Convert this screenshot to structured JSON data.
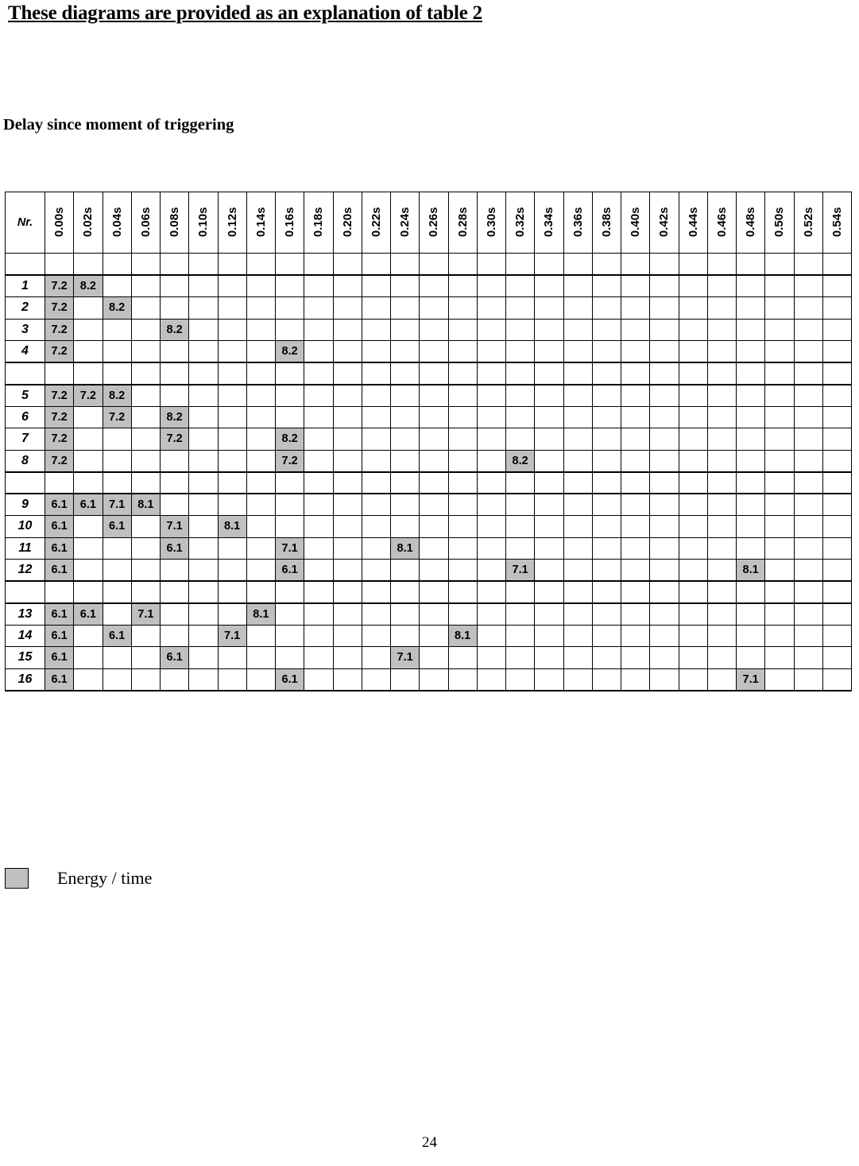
{
  "document": {
    "title": "These diagrams are provided as an explanation of table 2",
    "subheading": "Delay since moment of triggering",
    "page_number": "24"
  },
  "table": {
    "nr_header": "Nr.",
    "time_headers": [
      "0.00s",
      "0.02s",
      "0.04s",
      "0.06s",
      "0.08s",
      "0.10s",
      "0.12s",
      "0.14s",
      "0.16s",
      "0.18s",
      "0.20s",
      "0.22s",
      "0.24s",
      "0.26s",
      "0.28s",
      "0.30s",
      "0.32s",
      "0.34s",
      "0.36s",
      "0.38s",
      "0.40s",
      "0.42s",
      "0.44s",
      "0.46s",
      "0.48s",
      "0.50s",
      "0.52s",
      "0.54s"
    ],
    "column_count": 28,
    "highlight_color": "#c0c0c0",
    "rows": [
      {
        "type": "spacer"
      },
      {
        "type": "data",
        "group_start": true,
        "nr": "1",
        "cells": {
          "0": "7.2",
          "1": "8.2"
        }
      },
      {
        "type": "data",
        "nr": "2",
        "cells": {
          "0": "7.2",
          "2": "8.2"
        }
      },
      {
        "type": "data",
        "nr": "3",
        "cells": {
          "0": "7.2",
          "4": "8.2"
        }
      },
      {
        "type": "data",
        "nr": "4",
        "cells": {
          "0": "7.2",
          "8": "8.2"
        }
      },
      {
        "type": "spacer",
        "group_start": true
      },
      {
        "type": "data",
        "group_start": true,
        "nr": "5",
        "cells": {
          "0": "7.2",
          "1": "7.2",
          "2": "8.2"
        }
      },
      {
        "type": "data",
        "nr": "6",
        "cells": {
          "0": "7.2",
          "2": "7.2",
          "4": "8.2"
        }
      },
      {
        "type": "data",
        "nr": "7",
        "cells": {
          "0": "7.2",
          "4": "7.2",
          "8": "8.2"
        }
      },
      {
        "type": "data",
        "nr": "8",
        "cells": {
          "0": "7.2",
          "8": "7.2",
          "16": "8.2"
        }
      },
      {
        "type": "spacer",
        "group_start": true
      },
      {
        "type": "data",
        "group_start": true,
        "nr": "9",
        "cells": {
          "0": "6.1",
          "1": "6.1",
          "2": "7.1",
          "3": "8.1"
        }
      },
      {
        "type": "data",
        "nr": "10",
        "cells": {
          "0": "6.1",
          "2": "6.1",
          "4": "7.1",
          "6": "8.1"
        }
      },
      {
        "type": "data",
        "nr": "11",
        "cells": {
          "0": "6.1",
          "4": "6.1",
          "8": "7.1",
          "12": "8.1"
        }
      },
      {
        "type": "data",
        "nr": "12",
        "cells": {
          "0": "6.1",
          "8": "6.1",
          "16": "7.1",
          "24": "8.1"
        }
      },
      {
        "type": "spacer",
        "group_start": true
      },
      {
        "type": "data",
        "group_start": true,
        "nr": "13",
        "cells": {
          "0": "6.1",
          "1": "6.1",
          "3": "7.1",
          "7": "8.1"
        }
      },
      {
        "type": "data",
        "nr": "14",
        "cells": {
          "0": "6.1",
          "2": "6.1",
          "6": "7.1",
          "14": "8.1"
        }
      },
      {
        "type": "data",
        "nr": "15",
        "cells": {
          "0": "6.1",
          "4": "6.1",
          "12": "7.1"
        }
      },
      {
        "type": "data",
        "group_end": true,
        "nr": "16",
        "cells": {
          "0": "6.1",
          "8": "6.1",
          "24": "7.1"
        }
      }
    ]
  },
  "legend": {
    "label": "Energy / time"
  }
}
